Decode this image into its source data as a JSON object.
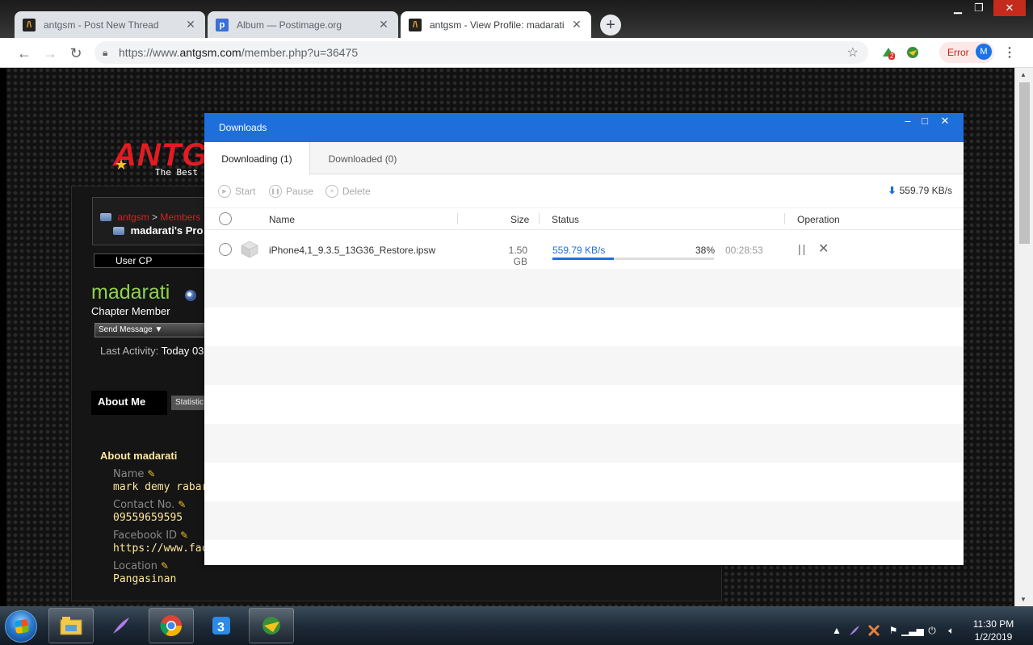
{
  "browser": {
    "tabs": [
      {
        "title": "antgsm - Post New Thread",
        "favicon": "antgsm-favicon",
        "active": false
      },
      {
        "title": "Album — Postimage.org",
        "favicon": "postimage-favicon",
        "active": false
      },
      {
        "title": "antgsm - View Profile: madarati",
        "favicon": "antgsm-favicon",
        "active": true
      }
    ],
    "url_prefix": "https://www.",
    "url_domain": "antgsm.com",
    "url_path": "/member.php?u=36475",
    "extension_badge": "2",
    "error_label": "Error",
    "avatar_letter": "M"
  },
  "website": {
    "logo_text": "ANTG",
    "tagline": "The Best",
    "breadcrumb": {
      "root": "antgsm",
      "separator": ">",
      "section": "Members",
      "current": "madarati's Pro"
    },
    "user_cp": "User CP",
    "profile_name": "madarati",
    "rank": "Chapter Member",
    "send_message": "Send Message",
    "last_activity_label": "Last Activity:",
    "last_activity_value": "Today 03",
    "tab_about": "About Me",
    "tab_stats": "Statistic",
    "about_heading": "About madarati",
    "fields": [
      {
        "label": "Name",
        "value": "mark demy rabar"
      },
      {
        "label": "Contact No.",
        "value": "09559659595"
      },
      {
        "label": "Facebook ID",
        "value": "https://www.face"
      },
      {
        "label": "Location",
        "value": "Pangasinan"
      }
    ]
  },
  "downloads": {
    "title": "Downloads",
    "tab_downloading": "Downloading (1)",
    "tab_downloaded": "Downloaded (0)",
    "action_start": "Start",
    "action_pause": "Pause",
    "action_delete": "Delete",
    "total_speed": "559.79 KB/s",
    "columns": {
      "name": "Name",
      "size": "Size",
      "status": "Status",
      "operation": "Operation"
    },
    "items": [
      {
        "name": "iPhone4,1_9.3.5_13G36_Restore.ipsw",
        "size": "1.50 GB",
        "speed": "559.79 KB/s",
        "percent": "38%",
        "progress": 0.38,
        "eta": "00:28:53"
      }
    ]
  },
  "taskbar": {
    "clock_time": "11:30 PM",
    "clock_date": "1/2/2019"
  },
  "colors": {
    "dialog_accent": "#1e6fdc",
    "profile_name": "#8fd14f",
    "site_red": "#e31b23"
  }
}
